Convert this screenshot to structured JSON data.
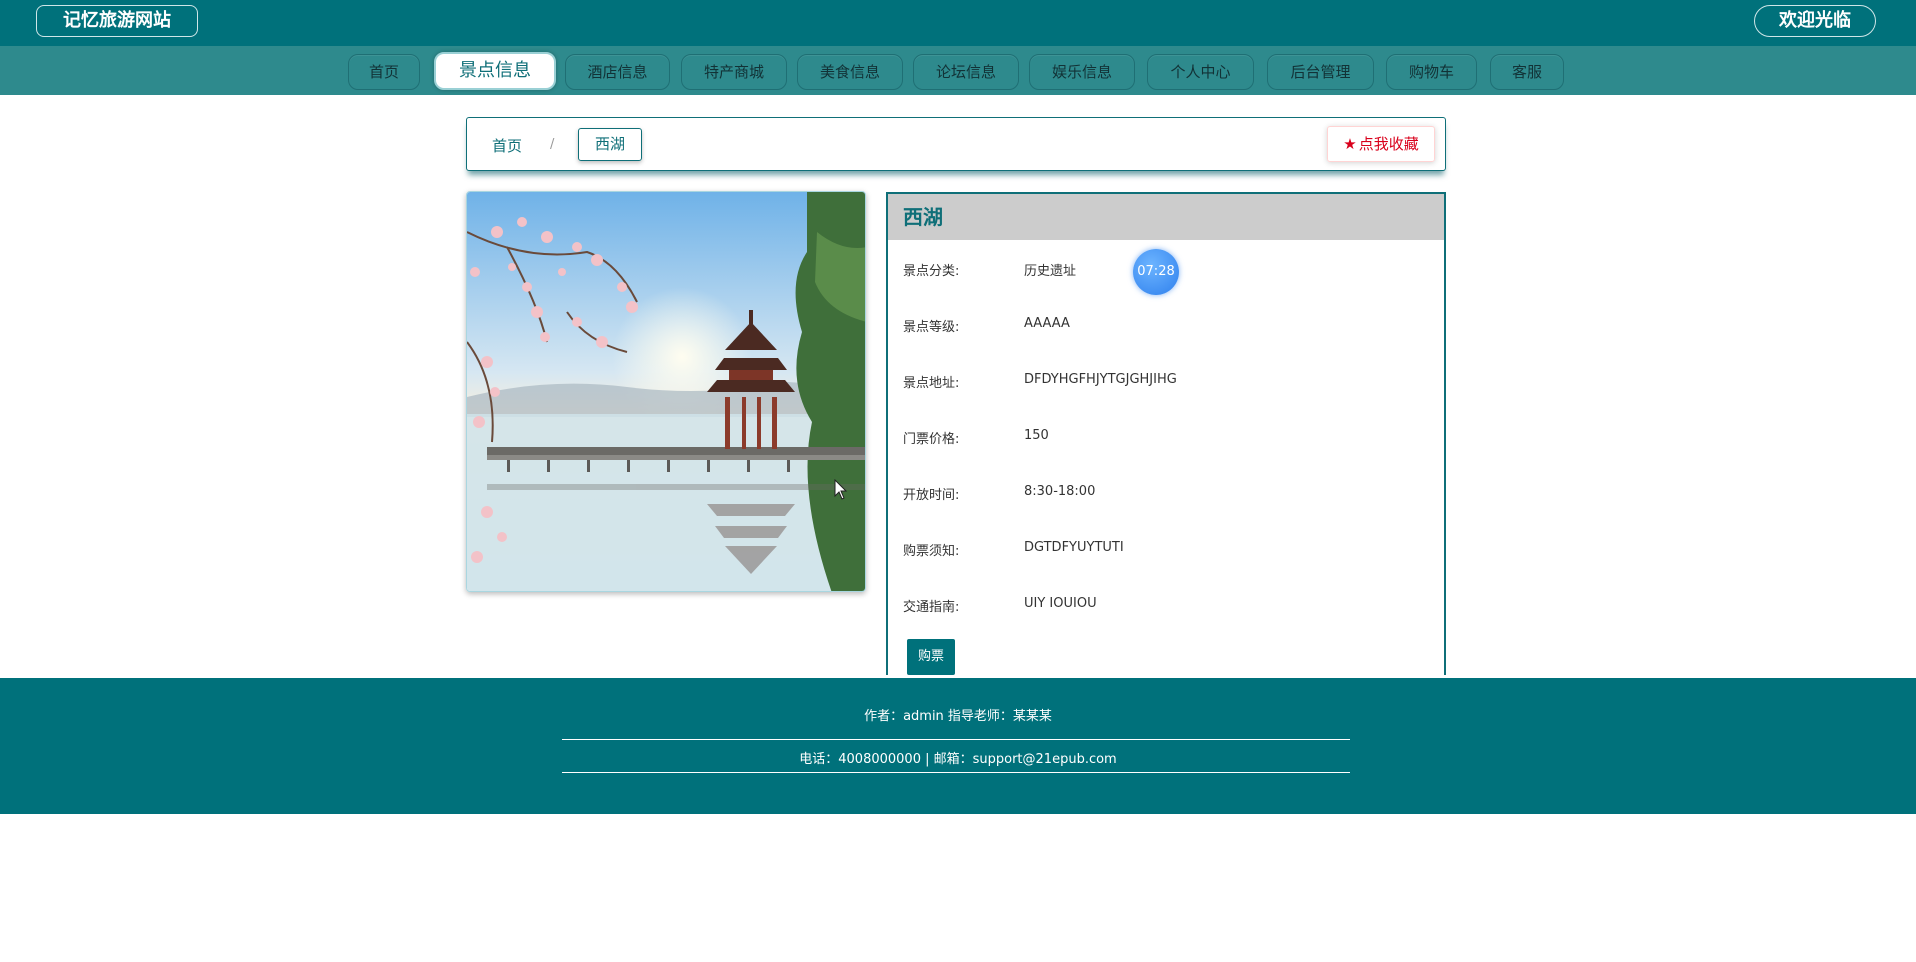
{
  "header": {
    "site_title": "记忆旅游网站",
    "welcome_text": "欢迎光临"
  },
  "nav": {
    "items": [
      "首页",
      "景点信息",
      "酒店信息",
      "特产商城",
      "美食信息",
      "论坛信息",
      "娱乐信息",
      "个人中心",
      "后台管理",
      "购物车",
      "客服"
    ],
    "active_label": "景点信息"
  },
  "breadcrumb": {
    "home": "首页",
    "separator": "/",
    "current": "西湖",
    "favorite_label": "点我收藏"
  },
  "detail": {
    "title": "西湖",
    "fields": [
      {
        "label": "景点分类:",
        "value": "历史遗址"
      },
      {
        "label": "景点等级:",
        "value": "AAAAA"
      },
      {
        "label": "景点地址:",
        "value": "DFDYHGFHJYTGJGHJIHG"
      },
      {
        "label": "门票价格:",
        "value": "150"
      },
      {
        "label": "开放时间:",
        "value": "8:30-18:00"
      },
      {
        "label": "购票须知:",
        "value": "DGTDFYUYTUTI"
      },
      {
        "label": "交通指南:",
        "value": "UIY IOUIOU"
      }
    ],
    "buy_label": "购票"
  },
  "clock_badge": "07:28",
  "footer": {
    "line1": "作者：admin 指导老师：某某某",
    "line2": "电话：4008000000 | 邮箱：support@21epub.com"
  },
  "colors": {
    "primary": "#00717b",
    "nav_bg": "#2e8a8d",
    "favorite": "#d9001b"
  }
}
